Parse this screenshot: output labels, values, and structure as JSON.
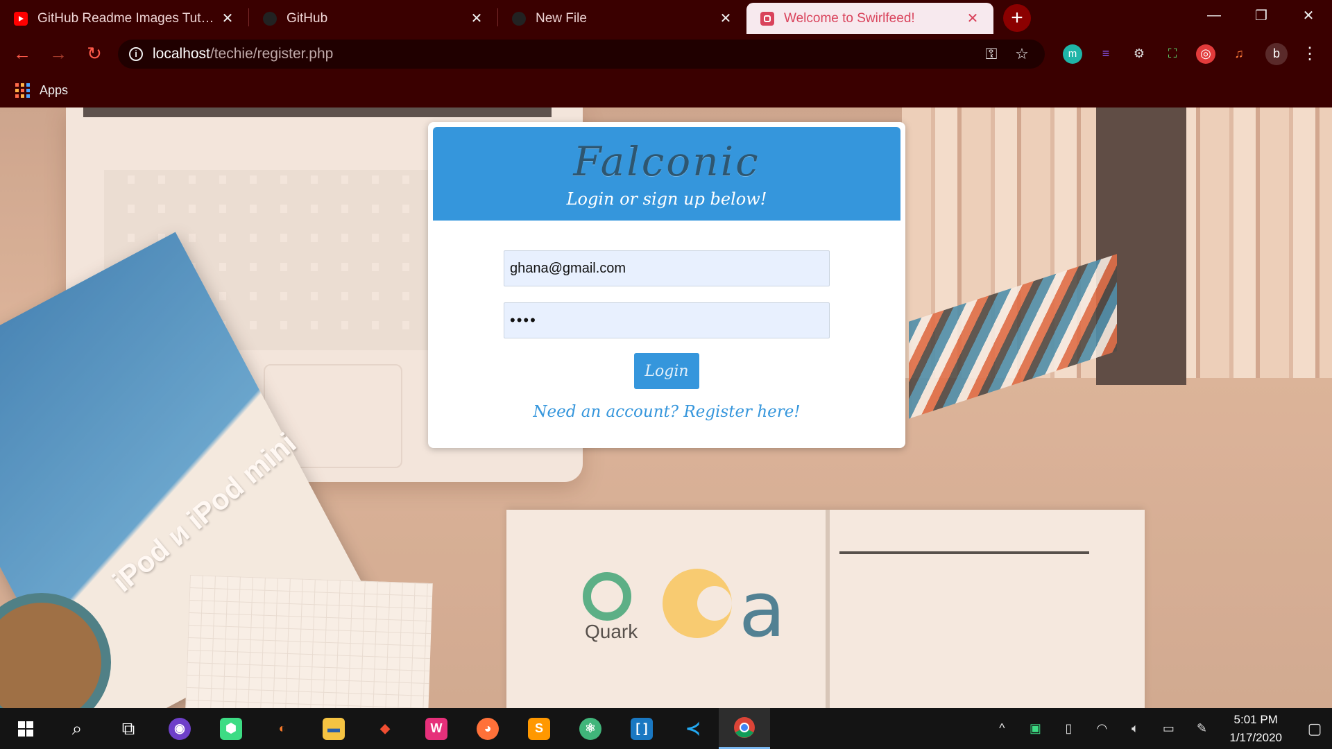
{
  "browser": {
    "tabs": [
      {
        "title": "GitHub Readme Images Tutorial (",
        "icon": "youtube-icon",
        "active": false
      },
      {
        "title": "GitHub",
        "icon": "github-icon",
        "active": false
      },
      {
        "title": "New File",
        "icon": "github-icon",
        "active": false
      },
      {
        "title": "Welcome to Swirlfeed!",
        "icon": "swirlfeed-icon",
        "active": true
      }
    ],
    "new_tab_label": "+",
    "url_host": "localhost",
    "url_path": "/techie/register.php",
    "bookmarks": {
      "apps_label": "Apps"
    },
    "profile_initial": "b"
  },
  "page": {
    "brand": "Falconic",
    "tagline": "Login or sign up below!",
    "email_value": "ghana@gmail.com",
    "password_value": "••••",
    "login_label": "Login",
    "register_link": "Need an account? Register here!",
    "background": {
      "magazine_text": "iPod и iPod mini",
      "quark_label": "Quark"
    }
  },
  "taskbar": {
    "time": "5:01 PM",
    "date": "1/17/2020"
  },
  "colors": {
    "accent_blue": "#3596dc",
    "chrome_bg": "#3a0000",
    "active_tab": "#d9425b"
  }
}
